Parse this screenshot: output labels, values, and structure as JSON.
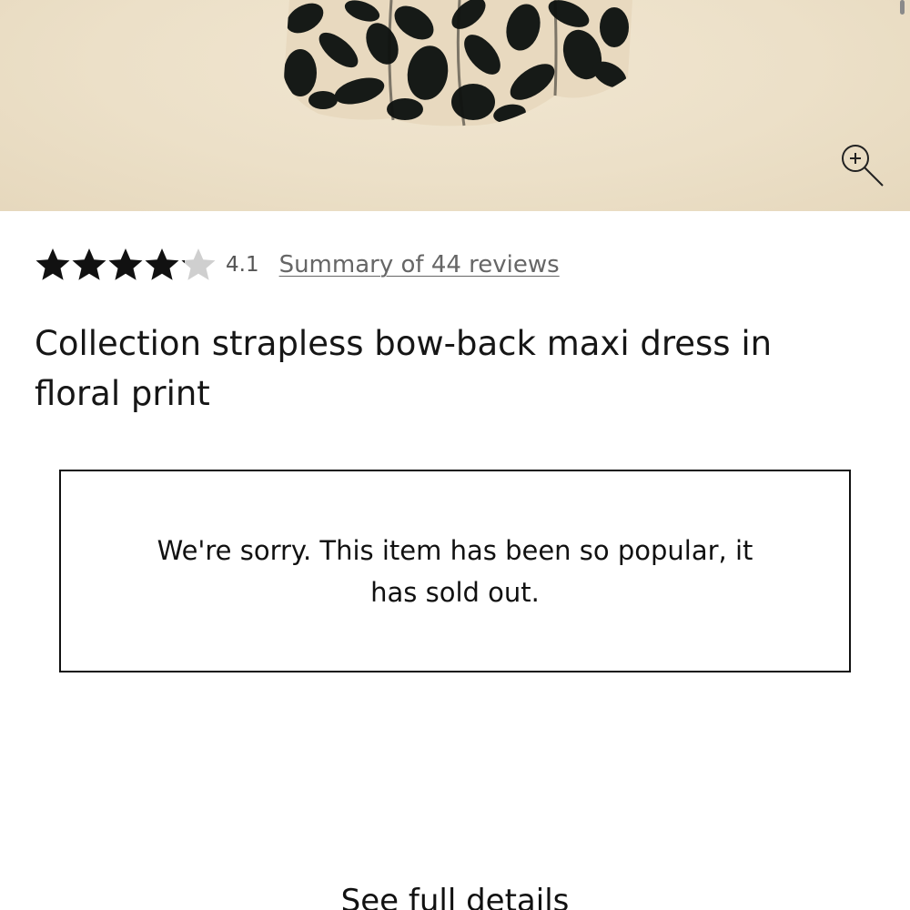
{
  "product": {
    "title": "Collection strapless bow-back maxi dress in floral print",
    "rating": {
      "value": "4.1",
      "stars_filled": 4.1,
      "stars_max": 5,
      "reviews_link": "Summary of 44 reviews"
    }
  },
  "image": {
    "description_icon": "zoom-in-icon"
  },
  "availability": {
    "message": "We're sorry. This item has been so popular, it has sold out."
  },
  "details": {
    "link_label": "See full details"
  },
  "colors": {
    "hero_background": "#ece0c8",
    "star_filled": "#111111",
    "star_empty": "#cfcfcf",
    "text": "#111111",
    "link": "#666666"
  }
}
